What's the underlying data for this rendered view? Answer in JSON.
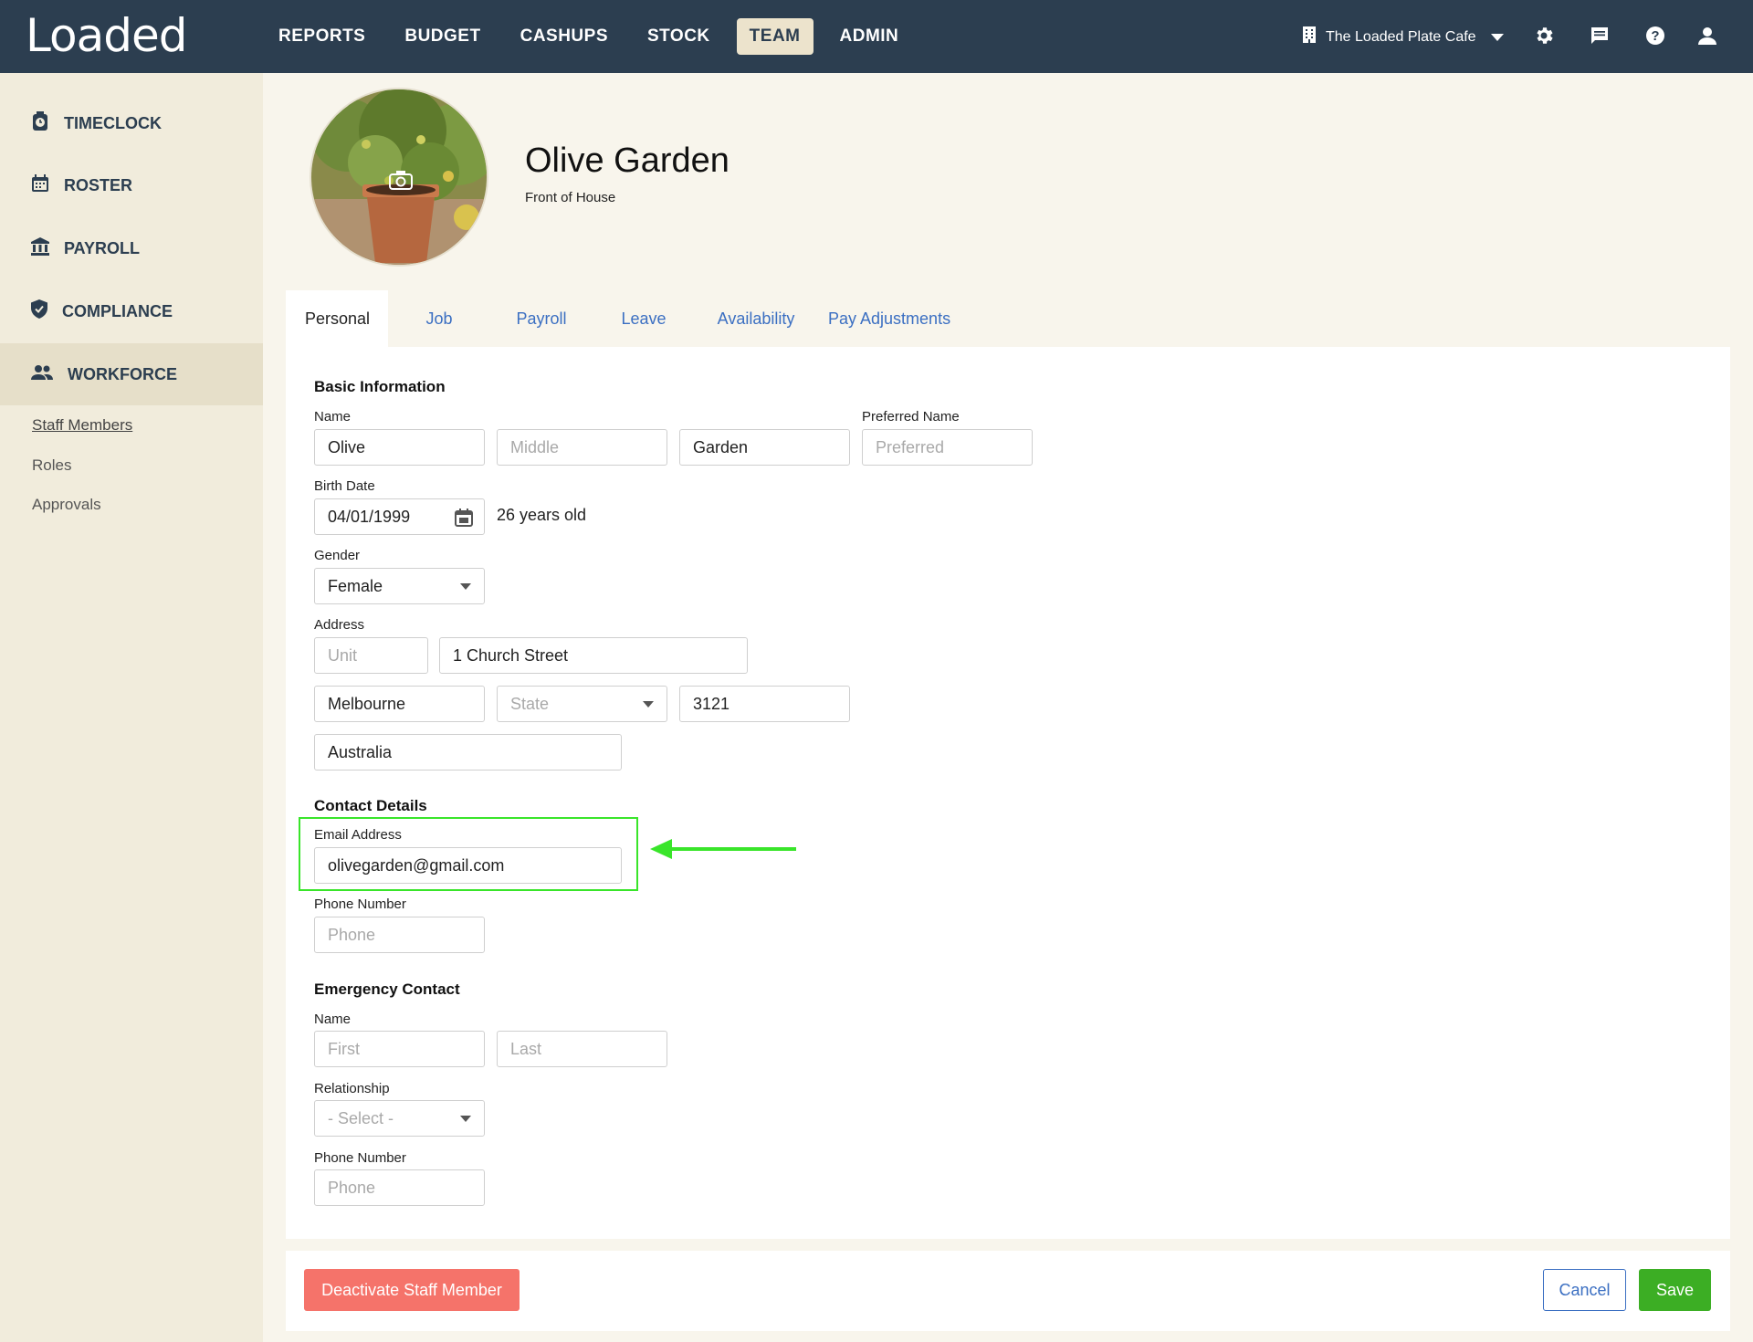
{
  "app": {
    "logo": "Loaded"
  },
  "topnav": {
    "items": [
      "REPORTS",
      "BUDGET",
      "CASHUPS",
      "STOCK",
      "TEAM",
      "ADMIN"
    ],
    "active": "TEAM",
    "venue": "The Loaded Plate Cafe"
  },
  "sidebar": {
    "items": [
      {
        "label": "TIMECLOCK",
        "icon": "timeclock-icon"
      },
      {
        "label": "ROSTER",
        "icon": "calendar-icon"
      },
      {
        "label": "PAYROLL",
        "icon": "bank-icon"
      },
      {
        "label": "COMPLIANCE",
        "icon": "shield-icon"
      },
      {
        "label": "WORKFORCE",
        "icon": "people-icon"
      }
    ],
    "sub": [
      "Staff Members",
      "Roles",
      "Approvals"
    ]
  },
  "profile": {
    "name": "Olive Garden",
    "role": "Front of House"
  },
  "tabs": [
    "Personal",
    "Job",
    "Payroll",
    "Leave",
    "Availability",
    "Pay Adjustments"
  ],
  "basic": {
    "title": "Basic Information",
    "name_label": "Name",
    "first": "Olive",
    "middle_ph": "Middle",
    "last": "Garden",
    "preferred_label": "Preferred Name",
    "preferred_ph": "Preferred",
    "birth_label": "Birth Date",
    "birth": "04/01/1999",
    "age": "26 years old",
    "gender_label": "Gender",
    "gender": "Female",
    "address_label": "Address",
    "unit_ph": "Unit",
    "street": "1 Church Street",
    "city": "Melbourne",
    "state_ph": "State",
    "postcode": "3121",
    "country": "Australia"
  },
  "contact": {
    "title": "Contact Details",
    "email_label": "Email Address",
    "email": "olivegarden@gmail.com",
    "phone_label": "Phone Number",
    "phone_ph": "Phone"
  },
  "emergency": {
    "title": "Emergency Contact",
    "name_label": "Name",
    "first_ph": "First",
    "last_ph": "Last",
    "rel_label": "Relationship",
    "rel_ph": "- Select -",
    "phone_label": "Phone Number",
    "phone_ph": "Phone"
  },
  "actions": {
    "deactivate": "Deactivate Staff Member",
    "cancel": "Cancel",
    "save": "Save"
  },
  "colors": {
    "topbar": "#2c3e50",
    "accent_link": "#3b6fc2",
    "save": "#3cae24",
    "deactivate": "#f5736a",
    "highlight": "#39e52a"
  }
}
